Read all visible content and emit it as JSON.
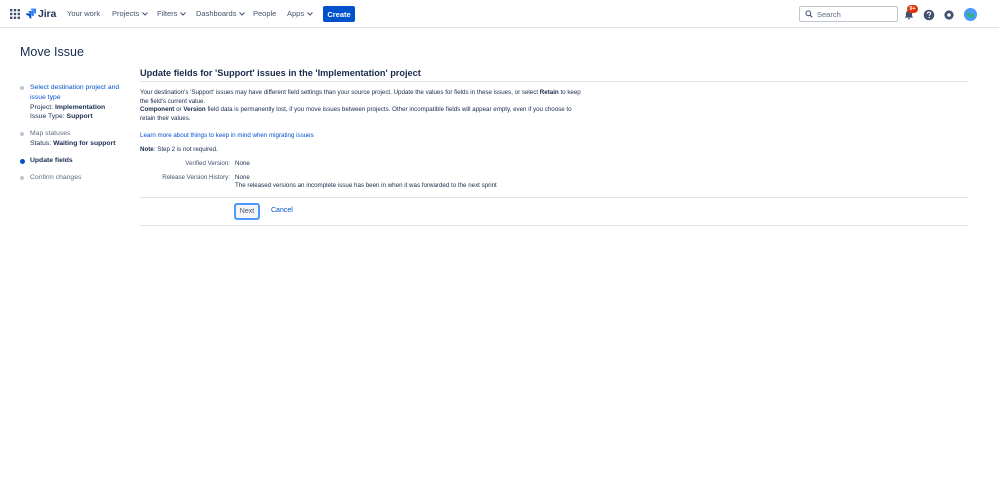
{
  "nav": {
    "logo": "Jira",
    "items": [
      {
        "label": "Your work",
        "dropdown": false
      },
      {
        "label": "Projects",
        "dropdown": true
      },
      {
        "label": "Filters",
        "dropdown": true
      },
      {
        "label": "Dashboards",
        "dropdown": true
      },
      {
        "label": "People",
        "dropdown": false
      },
      {
        "label": "Apps",
        "dropdown": true
      }
    ],
    "create_label": "Create",
    "search_placeholder": "Search",
    "notification_badge": "9+",
    "icons": [
      "app-switcher-icon",
      "search-icon",
      "bell-icon",
      "help-icon",
      "gear-icon",
      "avatar"
    ],
    "accent": "#0052cc"
  },
  "page": {
    "title": "Move Issue"
  },
  "steps": {
    "step1": {
      "label": "Select destination project and issue type",
      "project_prefix": "Project:",
      "project_value": "Implementation",
      "issuetype_prefix": "Issue Type:",
      "issuetype_value": "Support"
    },
    "step2": {
      "label": "Map statuses",
      "status_prefix": "Status:",
      "status_value": "Waiting for support"
    },
    "step3": {
      "label": "Update fields"
    },
    "step4": {
      "label": "Confirm changes"
    }
  },
  "content": {
    "title": "Update fields for 'Support' issues in the 'Implementation' project",
    "desc_part1": "Your destination's 'Support' issues may have different field settings than your source project. Update the values for fields in these issues, or select",
    "desc_retain": "Retain",
    "desc_part2": "to keep the field's current value.",
    "desc_component": "Component",
    "desc_or": "or",
    "desc_version": "Version",
    "desc_part3": "field data is permanently lost, if you move issues between projects. Other incompatible fields will appear empty, even if you choose to retain their values.",
    "learn_link": "Learn more about things to keep in mind when migrating issues",
    "note_label": "Note",
    "note_text": ": Step 2 is not required.",
    "fields": [
      {
        "label": "Verified Version:",
        "value": "None"
      },
      {
        "label": "Release Version History:",
        "value": "None",
        "sub": "The released versions an incomplete issue has been in when it was forwarded to the next sprint"
      }
    ],
    "next_label": "Next",
    "cancel_label": "Cancel"
  }
}
